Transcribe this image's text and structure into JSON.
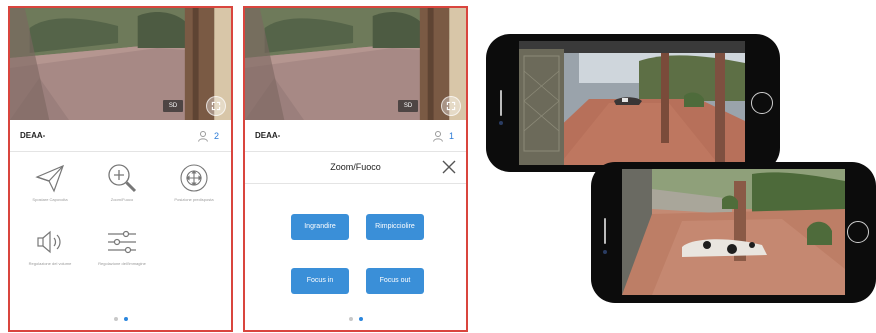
{
  "screen1": {
    "device_name": "DEAA-",
    "viewer_count": "2",
    "quality_badge": "SD",
    "menu": [
      {
        "icon": "paper-plane-icon",
        "caption": "Spostare Capovolta"
      },
      {
        "icon": "zoom-in-icon",
        "caption": "Zoom/Fuoco"
      },
      {
        "icon": "preset-position-icon",
        "caption": "Posizione predisposta"
      },
      {
        "icon": "speaker-volume-icon",
        "caption": "Regolazione del volume"
      },
      {
        "icon": "sliders-icon",
        "caption": "Regolazione dell'immagine"
      }
    ],
    "page_count": 2,
    "active_page": 2
  },
  "screen2": {
    "device_name": "DEAA-",
    "viewer_count": "1",
    "quality_badge": "SD",
    "panel_title": "Zoom/Fuoco",
    "buttons": {
      "zoom_in": "Ingrandire",
      "zoom_out": "Rimpicciolire",
      "focus_in": "Focus in",
      "focus_out": "Focus out"
    },
    "page_count": 2,
    "active_page": 2
  },
  "colors": {
    "accent_blue": "#3a8fd8",
    "screen_border": "#d9453e",
    "phone_body": "#0c0c0c"
  }
}
